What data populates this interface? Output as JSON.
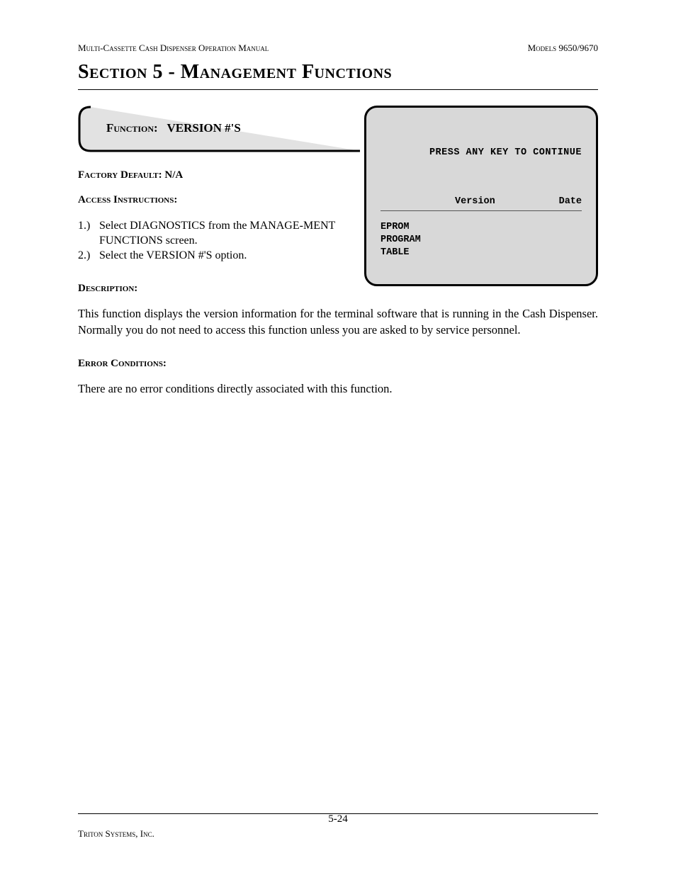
{
  "header": {
    "left": "Multi-Cassette Cash Dispenser Operation Manual",
    "right": "Models 9650/9670"
  },
  "section_title": "Section 5 - Management Functions",
  "function_tab": {
    "label": "Function:",
    "value": "VERSION #'S"
  },
  "factory_default": {
    "label": "Factory Default:",
    "value": "N/A"
  },
  "access_instructions_label": "Access Instructions:",
  "instructions": [
    {
      "num": "1.)",
      "text": "Select DIAGNOSTICS from the MANAGE-MENT FUNCTIONS screen."
    },
    {
      "num": "2.)",
      "text": "Select the VERSION #'S option."
    }
  ],
  "screenshot": {
    "press_line": "PRESS ANY KEY TO CONTINUE",
    "columns": {
      "c1": "",
      "c2": "Version",
      "c3": "Date"
    },
    "rows": [
      "EPROM",
      "PROGRAM",
      "TABLE"
    ]
  },
  "description_label": "Description:",
  "description_text": "This function displays the version information for the terminal software that is running in the Cash Dispenser.  Normally you do not need to access this function unless you are asked to by service personnel.",
  "error_label": "Error Conditions:",
  "error_text": "There are no error conditions directly associated with this function.",
  "footer": {
    "company": "Triton Systems, Inc.",
    "page": "5-24"
  }
}
